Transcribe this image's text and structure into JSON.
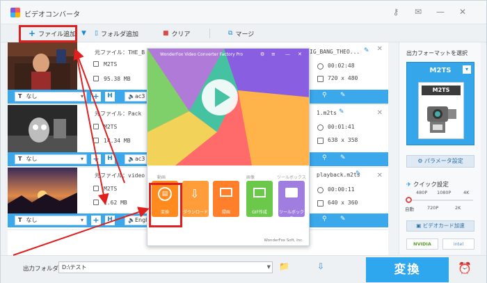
{
  "window": {
    "title": "ビデオコンバータ"
  },
  "toolbar": {
    "add_file": "ファイル追加",
    "add_folder": "フォルダ追加",
    "clear": "クリア",
    "merge": "マージ"
  },
  "files": [
    {
      "source_label": "元ファイル：THE_B",
      "format": "M2TS",
      "size": "95.38 MB",
      "output_name": "IG_BANG_THEO...",
      "duration": "00:02:48",
      "resolution": "720 x 480",
      "subtitle": "なし",
      "audio": "ac3"
    },
    {
      "source_label": "元ファイル：Pack",
      "format": "M2TS",
      "size": "14.34 MB",
      "output_name": "1.m2ts",
      "duration": "00:01:41",
      "resolution": "638 x 358",
      "subtitle": "なし",
      "audio": "ac3"
    },
    {
      "source_label": "元ファイル：video",
      "format": "M2TS",
      "size": "1.62 MB",
      "output_name": "playback.m2ts",
      "duration": "00:00:11",
      "resolution": "640 x 360",
      "subtitle": "なし",
      "audio": "Engl"
    }
  ],
  "output_panel": {
    "title": "出力フォーマットを選択",
    "format_name": "M2TS",
    "format_badge": "M2TS",
    "param_button": "パラメータ設定",
    "quick_title": "クイック設定",
    "quick_levels_top": [
      "480P",
      "1080P",
      "4K"
    ],
    "quick_levels_bottom": [
      "自動",
      "720P",
      "2K"
    ],
    "gpu_button": "ビデオカード加速",
    "gpu_vendors": [
      "NVIDIA",
      "intel"
    ]
  },
  "bottom": {
    "folder_label": "出力フォルダ：",
    "folder_value": "D:\\テスト",
    "convert_button": "変換"
  },
  "popup": {
    "title": "WonderFox Video Converter Factory Pro",
    "section_video": "動画",
    "section_audio": "画像",
    "section_tools": "ツールボックス",
    "tools": [
      "変換",
      "ダウンロード",
      "録画",
      "GIF作成",
      "ツールボックス"
    ],
    "footer": "WonderFox Soft, Inc."
  },
  "colors": {
    "accent": "#2fa7ef",
    "highlight_red": "#e01f1f"
  }
}
